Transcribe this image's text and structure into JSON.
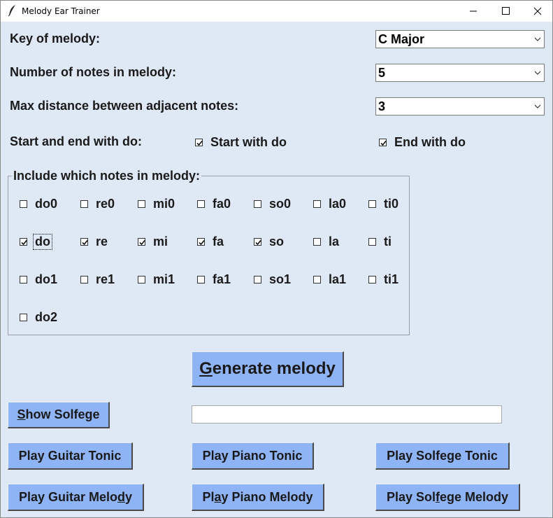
{
  "window": {
    "title": "Melody Ear Trainer"
  },
  "form": {
    "key_label": "Key of melody:",
    "key_value": "C Major",
    "num_notes_label": "Number of notes in melody:",
    "num_notes_value": "5",
    "max_distance_label": "Max distance between adjacent notes:",
    "max_distance_value": "3",
    "start_end_label": "Start and end with do:",
    "start_with_do": {
      "label": "Start with do",
      "checked": true
    },
    "end_with_do": {
      "label": "End with do",
      "checked": true
    }
  },
  "notes_group": {
    "title": "Include which notes in melody:",
    "rows": [
      [
        {
          "label": "do0",
          "checked": false
        },
        {
          "label": "re0",
          "checked": false
        },
        {
          "label": "mi0",
          "checked": false
        },
        {
          "label": "fa0",
          "checked": false
        },
        {
          "label": "so0",
          "checked": false
        },
        {
          "label": "la0",
          "checked": false
        },
        {
          "label": "ti0",
          "checked": false
        }
      ],
      [
        {
          "label": "do",
          "checked": true
        },
        {
          "label": "re",
          "checked": true
        },
        {
          "label": "mi",
          "checked": true
        },
        {
          "label": "fa",
          "checked": true
        },
        {
          "label": "so",
          "checked": true
        },
        {
          "label": "la",
          "checked": false
        },
        {
          "label": "ti",
          "checked": false
        }
      ],
      [
        {
          "label": "do1",
          "checked": false
        },
        {
          "label": "re1",
          "checked": false
        },
        {
          "label": "mi1",
          "checked": false
        },
        {
          "label": "fa1",
          "checked": false
        },
        {
          "label": "so1",
          "checked": false
        },
        {
          "label": "la1",
          "checked": false
        },
        {
          "label": "ti1",
          "checked": false
        }
      ],
      [
        {
          "label": "do2",
          "checked": false
        }
      ]
    ]
  },
  "buttons": {
    "generate": {
      "underline": "G",
      "rest": "enerate melody"
    },
    "show_solfege": {
      "underline": "S",
      "rest": "how Solfege"
    },
    "play_guitar_tonic": "Play Guitar Tonic",
    "play_piano_tonic": "Play Piano Tonic",
    "play_solfege_tonic": "Play Solfege Tonic",
    "play_guitar_melody": {
      "pre": "Play Guitar Melo",
      "underline": "d",
      "post": "y"
    },
    "play_piano_melody": {
      "pre": "Pl",
      "underline": "a",
      "post": "y Piano Melody"
    },
    "play_solfege_melody": {
      "pre": "Play Sol",
      "underline": "f",
      "post": "ege Melody"
    }
  },
  "solfege_output": {
    "value": ""
  }
}
